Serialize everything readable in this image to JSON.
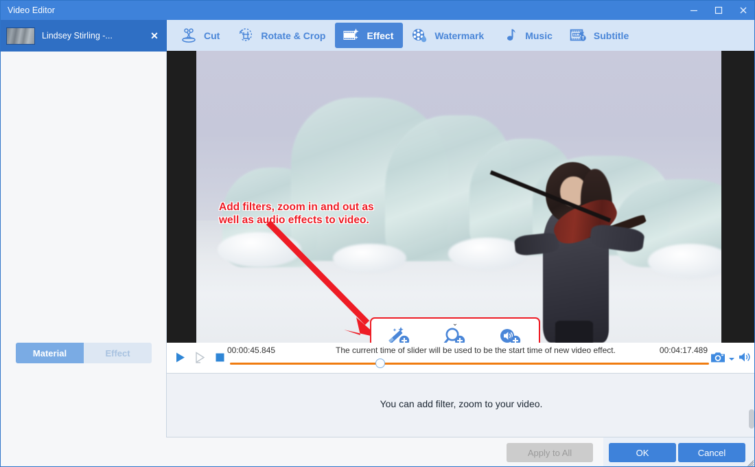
{
  "window": {
    "title": "Video Editor",
    "minimize_label": "—",
    "maximize_label": "□",
    "close_label": "✕"
  },
  "sidebar": {
    "clip": {
      "title": "Lindsey Stirling -...",
      "close_label": "✕",
      "thumbnail_name": "clip-thumbnail"
    },
    "tabs": [
      {
        "label": "Material",
        "active": true
      },
      {
        "label": "Effect",
        "active": false
      }
    ]
  },
  "toolbar": {
    "items": [
      {
        "label": "Cut",
        "icon": "cut-icon",
        "active": false
      },
      {
        "label": "Rotate & Crop",
        "icon": "rotate-crop-icon",
        "active": false
      },
      {
        "label": "Effect",
        "icon": "effect-icon",
        "active": true
      },
      {
        "label": "Watermark",
        "icon": "watermark-icon",
        "active": false
      },
      {
        "label": "Music",
        "icon": "music-note-icon",
        "active": false
      },
      {
        "label": "Subtitle",
        "icon": "subtitle-icon",
        "active": false
      }
    ]
  },
  "preview": {
    "annotation": "Add filters, zoom in and out as\nwell as audio effects to video.",
    "annotation_color": "#ee1c25",
    "effect_popup": {
      "chevron_label": "⌄",
      "buttons": [
        {
          "name": "add-filter-button",
          "icon": "magic-wand-plus-icon"
        },
        {
          "name": "add-zoom-button",
          "icon": "magnifier-plus-icon"
        },
        {
          "name": "add-audio-effect-button",
          "icon": "speaker-plus-icon"
        }
      ]
    }
  },
  "player": {
    "play_label": "▶",
    "step_label": "▷",
    "stop_label": "■",
    "current_time": "00:00:45.845",
    "total_time": "00:04:17.489",
    "hint": "The current time of slider will be used to be the start time of new video effect.",
    "progress_percent": 30,
    "track_color": "#f07c10",
    "snapshot_icon": "camera-icon",
    "snapshot_dropdown_icon": "chevron-down-icon",
    "volume_icon": "speaker-icon"
  },
  "panel": {
    "message": "You can add filter, zoom to your video."
  },
  "footer": {
    "apply_to_all": "Apply to All",
    "apply_to_all_disabled": true,
    "ok": "OK",
    "cancel": "Cancel"
  },
  "colors": {
    "accent": "#3e82da",
    "toolbar_bg": "#d6e5f7",
    "active_tool": "#4a86d8",
    "annotation": "#ee1c25",
    "track": "#f07c10"
  }
}
